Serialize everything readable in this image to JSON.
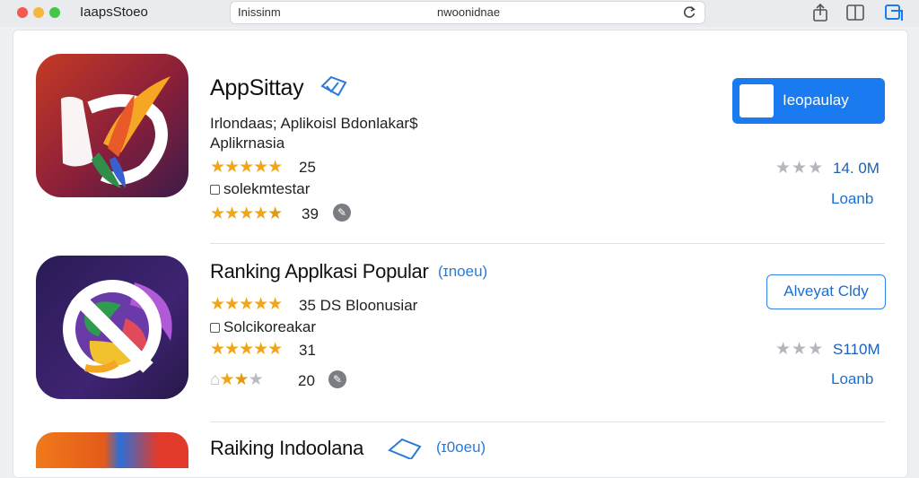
{
  "window": {
    "app_title": "IaapsStoeo",
    "url_left": "Inissinm",
    "url_center": "nwoonidnae"
  },
  "apps": [
    {
      "title": "AppSittay",
      "line1": "Irlondaas; Aplikoisl Bdonlakar$",
      "line2": "Aplikrnasia",
      "rating1_stars": 5,
      "rating1_value": "25",
      "line3": "solekmtestar",
      "rating2_stars": 4.5,
      "rating2_value": "39",
      "button": "Ieopaulay",
      "stat": "14. 0M",
      "link": "Loanb"
    },
    {
      "title": "Ranking Applkasi Popular",
      "badge": "(ɪnoeu)",
      "line1_value": "35",
      "line1_text": "DS Bloonusiar",
      "rating1_stars": 5,
      "line3": "Solcikoreakar",
      "rating2_stars": 5,
      "rating2_value": "31",
      "rating3_stars": 2.5,
      "rating3_value": "20",
      "button": "Alveyat Cldy",
      "stat": "S110M",
      "link": "Loanb"
    },
    {
      "title": "Raiking Indoolana",
      "badge": "(ɪ0oeu)"
    }
  ],
  "colors": {
    "accent": "#1a7af0",
    "star": "#f2a516",
    "link": "#1a6fd6"
  }
}
